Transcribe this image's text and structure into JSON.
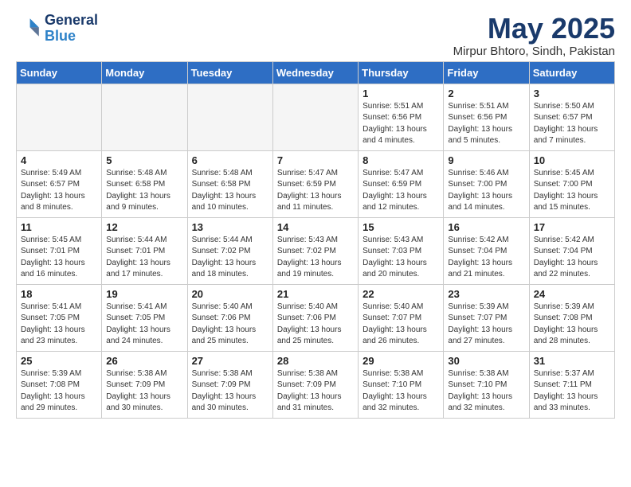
{
  "logo": {
    "line1": "General",
    "line2": "Blue"
  },
  "title": "May 2025",
  "subtitle": "Mirpur Bhtoro, Sindh, Pakistan",
  "weekdays": [
    "Sunday",
    "Monday",
    "Tuesday",
    "Wednesday",
    "Thursday",
    "Friday",
    "Saturday"
  ],
  "weeks": [
    [
      {
        "day": "",
        "info": ""
      },
      {
        "day": "",
        "info": ""
      },
      {
        "day": "",
        "info": ""
      },
      {
        "day": "",
        "info": ""
      },
      {
        "day": "1",
        "info": "Sunrise: 5:51 AM\nSunset: 6:56 PM\nDaylight: 13 hours\nand 4 minutes."
      },
      {
        "day": "2",
        "info": "Sunrise: 5:51 AM\nSunset: 6:56 PM\nDaylight: 13 hours\nand 5 minutes."
      },
      {
        "day": "3",
        "info": "Sunrise: 5:50 AM\nSunset: 6:57 PM\nDaylight: 13 hours\nand 7 minutes."
      }
    ],
    [
      {
        "day": "4",
        "info": "Sunrise: 5:49 AM\nSunset: 6:57 PM\nDaylight: 13 hours\nand 8 minutes."
      },
      {
        "day": "5",
        "info": "Sunrise: 5:48 AM\nSunset: 6:58 PM\nDaylight: 13 hours\nand 9 minutes."
      },
      {
        "day": "6",
        "info": "Sunrise: 5:48 AM\nSunset: 6:58 PM\nDaylight: 13 hours\nand 10 minutes."
      },
      {
        "day": "7",
        "info": "Sunrise: 5:47 AM\nSunset: 6:59 PM\nDaylight: 13 hours\nand 11 minutes."
      },
      {
        "day": "8",
        "info": "Sunrise: 5:47 AM\nSunset: 6:59 PM\nDaylight: 13 hours\nand 12 minutes."
      },
      {
        "day": "9",
        "info": "Sunrise: 5:46 AM\nSunset: 7:00 PM\nDaylight: 13 hours\nand 14 minutes."
      },
      {
        "day": "10",
        "info": "Sunrise: 5:45 AM\nSunset: 7:00 PM\nDaylight: 13 hours\nand 15 minutes."
      }
    ],
    [
      {
        "day": "11",
        "info": "Sunrise: 5:45 AM\nSunset: 7:01 PM\nDaylight: 13 hours\nand 16 minutes."
      },
      {
        "day": "12",
        "info": "Sunrise: 5:44 AM\nSunset: 7:01 PM\nDaylight: 13 hours\nand 17 minutes."
      },
      {
        "day": "13",
        "info": "Sunrise: 5:44 AM\nSunset: 7:02 PM\nDaylight: 13 hours\nand 18 minutes."
      },
      {
        "day": "14",
        "info": "Sunrise: 5:43 AM\nSunset: 7:02 PM\nDaylight: 13 hours\nand 19 minutes."
      },
      {
        "day": "15",
        "info": "Sunrise: 5:43 AM\nSunset: 7:03 PM\nDaylight: 13 hours\nand 20 minutes."
      },
      {
        "day": "16",
        "info": "Sunrise: 5:42 AM\nSunset: 7:04 PM\nDaylight: 13 hours\nand 21 minutes."
      },
      {
        "day": "17",
        "info": "Sunrise: 5:42 AM\nSunset: 7:04 PM\nDaylight: 13 hours\nand 22 minutes."
      }
    ],
    [
      {
        "day": "18",
        "info": "Sunrise: 5:41 AM\nSunset: 7:05 PM\nDaylight: 13 hours\nand 23 minutes."
      },
      {
        "day": "19",
        "info": "Sunrise: 5:41 AM\nSunset: 7:05 PM\nDaylight: 13 hours\nand 24 minutes."
      },
      {
        "day": "20",
        "info": "Sunrise: 5:40 AM\nSunset: 7:06 PM\nDaylight: 13 hours\nand 25 minutes."
      },
      {
        "day": "21",
        "info": "Sunrise: 5:40 AM\nSunset: 7:06 PM\nDaylight: 13 hours\nand 25 minutes."
      },
      {
        "day": "22",
        "info": "Sunrise: 5:40 AM\nSunset: 7:07 PM\nDaylight: 13 hours\nand 26 minutes."
      },
      {
        "day": "23",
        "info": "Sunrise: 5:39 AM\nSunset: 7:07 PM\nDaylight: 13 hours\nand 27 minutes."
      },
      {
        "day": "24",
        "info": "Sunrise: 5:39 AM\nSunset: 7:08 PM\nDaylight: 13 hours\nand 28 minutes."
      }
    ],
    [
      {
        "day": "25",
        "info": "Sunrise: 5:39 AM\nSunset: 7:08 PM\nDaylight: 13 hours\nand 29 minutes."
      },
      {
        "day": "26",
        "info": "Sunrise: 5:38 AM\nSunset: 7:09 PM\nDaylight: 13 hours\nand 30 minutes."
      },
      {
        "day": "27",
        "info": "Sunrise: 5:38 AM\nSunset: 7:09 PM\nDaylight: 13 hours\nand 30 minutes."
      },
      {
        "day": "28",
        "info": "Sunrise: 5:38 AM\nSunset: 7:09 PM\nDaylight: 13 hours\nand 31 minutes."
      },
      {
        "day": "29",
        "info": "Sunrise: 5:38 AM\nSunset: 7:10 PM\nDaylight: 13 hours\nand 32 minutes."
      },
      {
        "day": "30",
        "info": "Sunrise: 5:38 AM\nSunset: 7:10 PM\nDaylight: 13 hours\nand 32 minutes."
      },
      {
        "day": "31",
        "info": "Sunrise: 5:37 AM\nSunset: 7:11 PM\nDaylight: 13 hours\nand 33 minutes."
      }
    ]
  ]
}
